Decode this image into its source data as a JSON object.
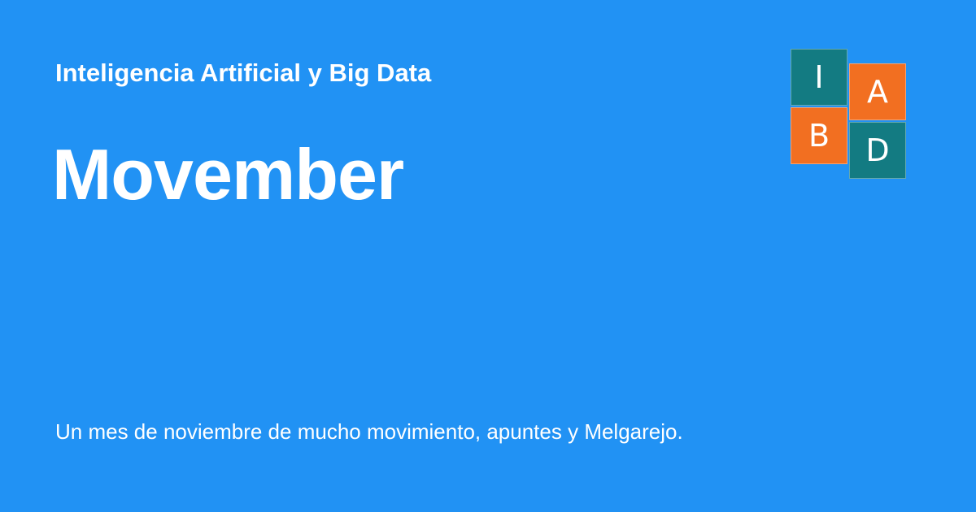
{
  "site": {
    "name": "Inteligencia Artificial y Big Data"
  },
  "post": {
    "title": "Movember",
    "description": "Un mes de noviembre de mucho movimiento, apuntes y Melgarejo."
  },
  "logo": {
    "tiles": [
      {
        "letter": "I",
        "color": "#137b82"
      },
      {
        "letter": "A",
        "color": "#f26f21"
      },
      {
        "letter": "B",
        "color": "#f26f21"
      },
      {
        "letter": "D",
        "color": "#137b82"
      }
    ]
  },
  "colors": {
    "background": "#2192f4",
    "text": "#ffffff",
    "teal": "#137b82",
    "orange": "#f26f21"
  }
}
